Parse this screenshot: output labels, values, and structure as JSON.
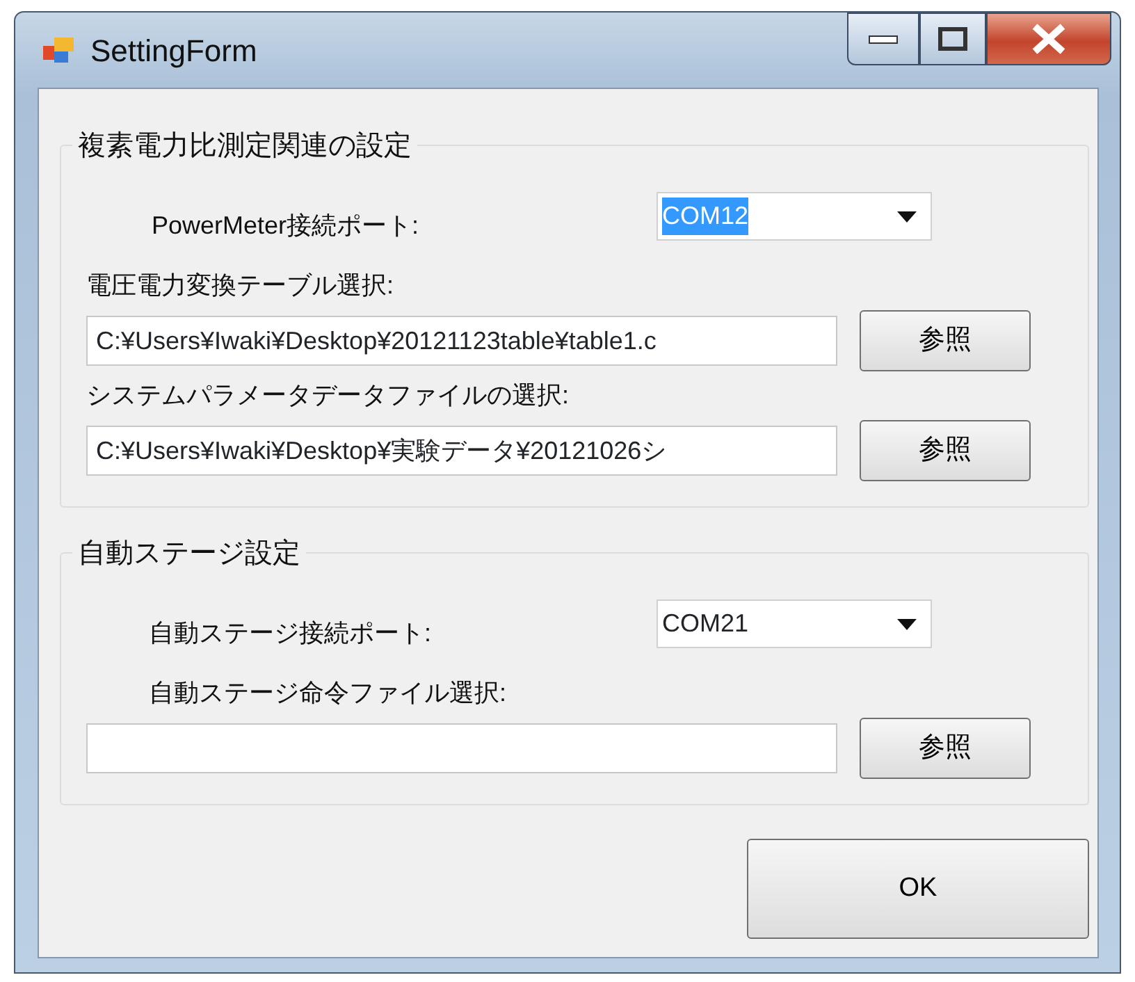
{
  "window": {
    "title": "SettingForm"
  },
  "groups": [
    {
      "title": "複素電力比測定関連の設定",
      "rows": [
        {
          "kind": "combo",
          "label": "PowerMeter接続ポート:",
          "value": "COM12",
          "focused": true
        },
        {
          "kind": "file",
          "label": "電圧電力変換テーブル選択:",
          "value": "C:¥Users¥Iwaki¥Desktop¥20121123table¥table1.c",
          "button": "参照"
        },
        {
          "kind": "file",
          "label": "システムパラメータデータファイルの選択:",
          "value": "C:¥Users¥Iwaki¥Desktop¥実験データ¥20121026シ",
          "button": "参照"
        }
      ]
    },
    {
      "title": "自動ステージ設定",
      "rows": [
        {
          "kind": "combo",
          "label": "自動ステージ接続ポート:",
          "value": "COM21",
          "focused": false
        },
        {
          "kind": "file",
          "label": "自動ステージ命令ファイル選択:",
          "button": "参照"
        }
      ]
    }
  ],
  "ok_button": "OK"
}
